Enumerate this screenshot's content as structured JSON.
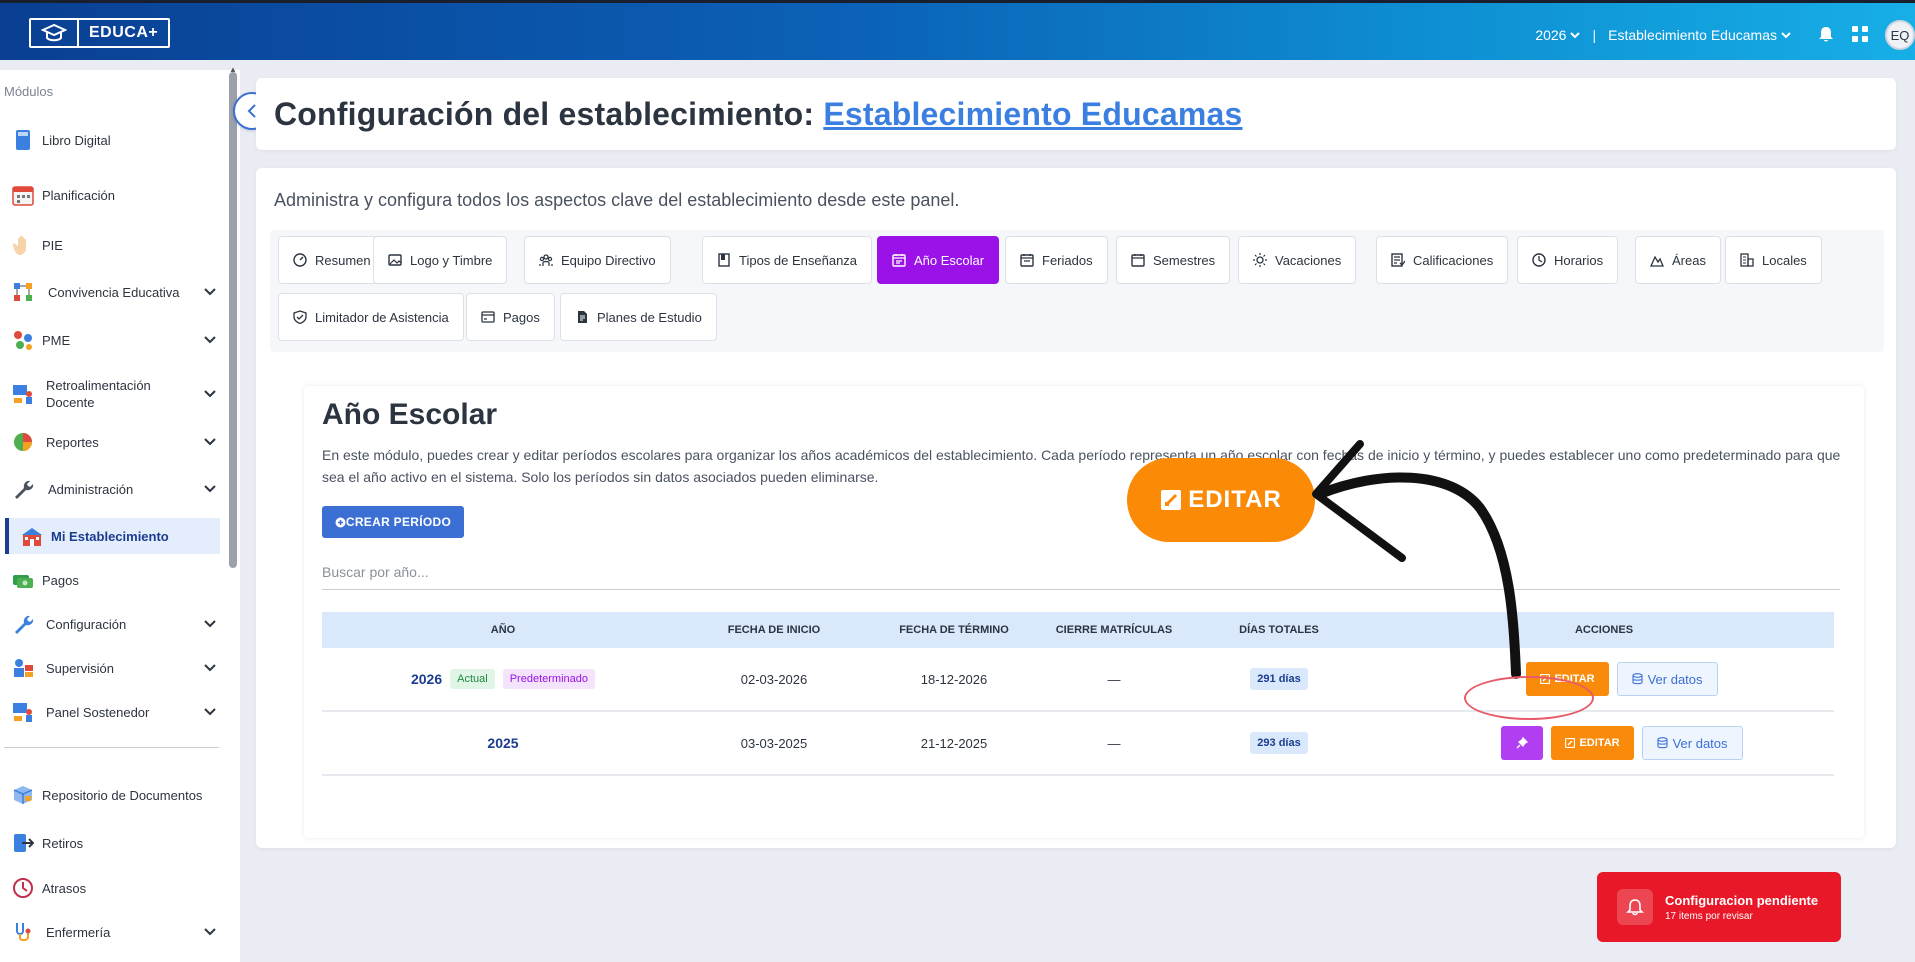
{
  "app": {
    "logo_text": "EDUCA+"
  },
  "topbar": {
    "year": "2026",
    "establishment": "Establecimiento Educamas",
    "avatar": "EQ"
  },
  "sidebar": {
    "title": "Módulos",
    "items": [
      {
        "label": "Libro Digital"
      },
      {
        "label": "Planificación"
      },
      {
        "label": "PIE"
      },
      {
        "label": "Convivencia Educativa"
      },
      {
        "label": "PME"
      },
      {
        "label": "Retroalimentación Docente"
      },
      {
        "label": "Reportes"
      },
      {
        "label": "Administración"
      },
      {
        "label": "Mi Establecimiento"
      },
      {
        "label": "Pagos"
      },
      {
        "label": "Configuración"
      },
      {
        "label": "Supervisión"
      },
      {
        "label": "Panel Sostenedor"
      },
      {
        "label": "Repositorio de Documentos"
      },
      {
        "label": "Retiros"
      },
      {
        "label": "Atrasos"
      },
      {
        "label": "Enfermería"
      }
    ]
  },
  "header": {
    "title_prefix": "Configuración del establecimiento:",
    "title_link": "Establecimiento Educamas"
  },
  "main": {
    "description": "Administra y configura todos los aspectos clave del establecimiento desde este panel.",
    "tabs": [
      {
        "label": "Resumen"
      },
      {
        "label": "Logo y Timbre"
      },
      {
        "label": "Equipo Directivo"
      },
      {
        "label": "Tipos de Enseñanza"
      },
      {
        "label": "Año Escolar"
      },
      {
        "label": "Feriados"
      },
      {
        "label": "Semestres"
      },
      {
        "label": "Vacaciones"
      },
      {
        "label": "Calificaciones"
      },
      {
        "label": "Horarios"
      },
      {
        "label": "Áreas"
      },
      {
        "label": "Locales"
      },
      {
        "label": "Limitador de Asistencia"
      },
      {
        "label": "Pagos"
      },
      {
        "label": "Planes de Estudio"
      }
    ],
    "active_tab": "Año Escolar"
  },
  "section": {
    "title": "Año Escolar",
    "description": "En este módulo, puedes crear y editar períodos escolares para organizar los años académicos del establecimiento. Cada período representa un año escolar con fechas de inicio y término, y puedes establecer uno como predeterminado para que sea el año activo en el sistema. Solo los períodos sin datos asociados pueden eliminarse.",
    "create_button": "CREAR PERÍODO",
    "search_placeholder": "Buscar por año..."
  },
  "table": {
    "headers": [
      "AÑO",
      "FECHA DE INICIO",
      "FECHA DE TÉRMINO",
      "CIERRE MATRÍCULAS",
      "DÍAS TOTALES",
      "ACCIONES"
    ],
    "rows": [
      {
        "year": "2026",
        "badge1": "Actual",
        "badge2": "Predeterminado",
        "start": "02-03-2026",
        "end": "18-12-2026",
        "closing": "—",
        "days": "291 días",
        "edit": "EDITAR",
        "view": "Ver datos"
      },
      {
        "year": "2025",
        "start": "03-03-2025",
        "end": "21-12-2025",
        "closing": "—",
        "days": "293 días",
        "edit": "EDITAR",
        "view": "Ver datos"
      }
    ]
  },
  "annotation": {
    "big_edit_label": "EDITAR"
  },
  "toast": {
    "title": "Configuracion pendiente",
    "subtitle": "17 items por revisar"
  },
  "colors": {
    "accent": "#3b6fd4",
    "active_tab": "#9a12e8",
    "edit": "#f98a0a",
    "toast": "#e81828"
  }
}
